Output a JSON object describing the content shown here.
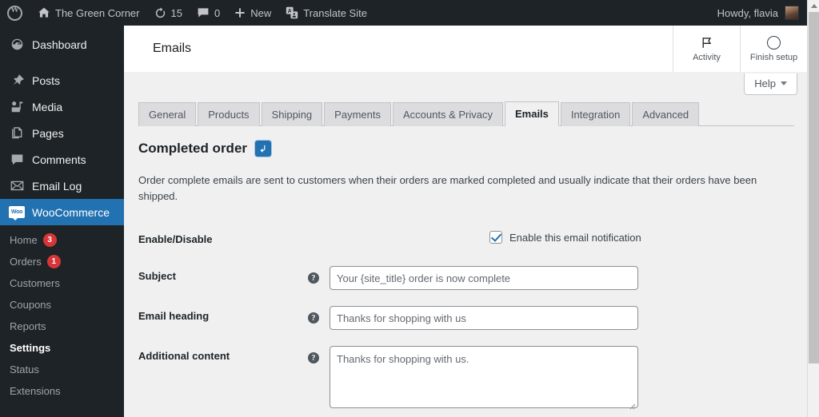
{
  "adminbar": {
    "logo_name": "wordpress-logo-icon",
    "site_name": "The Green Corner",
    "updates_count": "15",
    "comments_count": "0",
    "new_label": "New",
    "translate_label": "Translate Site",
    "howdy": "Howdy, flavia"
  },
  "sidebar": {
    "items": [
      {
        "label": "Dashboard",
        "icon": "dashboard-icon"
      },
      {
        "label": "Posts",
        "icon": "pin-icon"
      },
      {
        "label": "Media",
        "icon": "media-icon"
      },
      {
        "label": "Pages",
        "icon": "pages-icon"
      },
      {
        "label": "Comments",
        "icon": "comment-icon"
      },
      {
        "label": "Email Log",
        "icon": "envelope-icon"
      },
      {
        "label": "WooCommerce",
        "icon": "woocommerce-icon"
      }
    ],
    "submenu": [
      {
        "label": "Home",
        "badge": "3"
      },
      {
        "label": "Orders",
        "badge": "1"
      },
      {
        "label": "Customers",
        "badge": ""
      },
      {
        "label": "Coupons",
        "badge": ""
      },
      {
        "label": "Reports",
        "badge": ""
      },
      {
        "label": "Settings",
        "badge": ""
      },
      {
        "label": "Status",
        "badge": ""
      },
      {
        "label": "Extensions",
        "badge": ""
      }
    ],
    "active_item": "WooCommerce",
    "active_subitem": "Settings"
  },
  "header": {
    "title": "Emails",
    "activity_label": "Activity",
    "finish_setup_label": "Finish setup",
    "help_label": "Help"
  },
  "tabs": [
    {
      "label": "General",
      "active": false
    },
    {
      "label": "Products",
      "active": false
    },
    {
      "label": "Shipping",
      "active": false
    },
    {
      "label": "Payments",
      "active": false
    },
    {
      "label": "Accounts & Privacy",
      "active": false
    },
    {
      "label": "Emails",
      "active": true
    },
    {
      "label": "Integration",
      "active": false
    },
    {
      "label": "Advanced",
      "active": false
    }
  ],
  "section": {
    "title": "Completed order",
    "badge_icon": "undo-arrow-icon",
    "description": "Order complete emails are sent to customers when their orders are marked completed and usually indicate that their orders have been shipped."
  },
  "form": {
    "enable_label": "Enable/Disable",
    "enable_checkbox_label": "Enable this email notification",
    "enable_checked": true,
    "subject_label": "Subject",
    "subject_value": "",
    "subject_placeholder": "Your {site_title} order is now complete",
    "heading_label": "Email heading",
    "heading_value": "",
    "heading_placeholder": "Thanks for shopping with us",
    "additional_label": "Additional content",
    "additional_value": "",
    "additional_placeholder": "Thanks for shopping with us."
  },
  "colors": {
    "admin_dark": "#1d2327",
    "accent_blue": "#2271b1",
    "badge_red": "#d63638",
    "content_bg": "#f0f0f1"
  }
}
